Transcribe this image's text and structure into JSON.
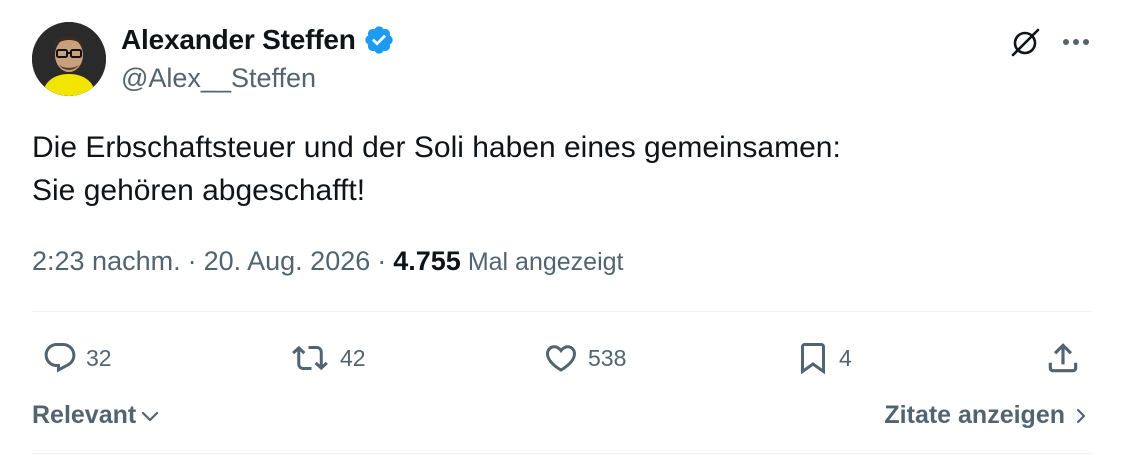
{
  "author": {
    "display_name": "Alexander Steffen",
    "handle": "@Alex__Steffen",
    "verified": true,
    "verified_color": "#1d9bf0"
  },
  "tweet": {
    "lines": [
      "Die Erbschaftsteuer und der Soli haben eines gemeinsamen:",
      "Sie gehören abgeschafft!"
    ],
    "time": "2:23 nachm.",
    "separator": "·",
    "date": "20. Aug. 2026",
    "views_count": "4.755",
    "views_label": "Mal angezeigt"
  },
  "actions": {
    "replies": "32",
    "reposts": "42",
    "likes": "538",
    "bookmarks": "4"
  },
  "footer": {
    "sort_label": "Relevant",
    "quotes_label": "Zitate anzeigen"
  },
  "icons": {
    "top_right": [
      "grok-icon",
      "more-icon"
    ],
    "action_bar": [
      "reply-icon",
      "repost-icon",
      "like-icon",
      "bookmark-icon",
      "share-icon"
    ]
  },
  "colors": {
    "text_primary": "#0f1419",
    "text_secondary": "#536471",
    "divider": "#eff3f4"
  }
}
